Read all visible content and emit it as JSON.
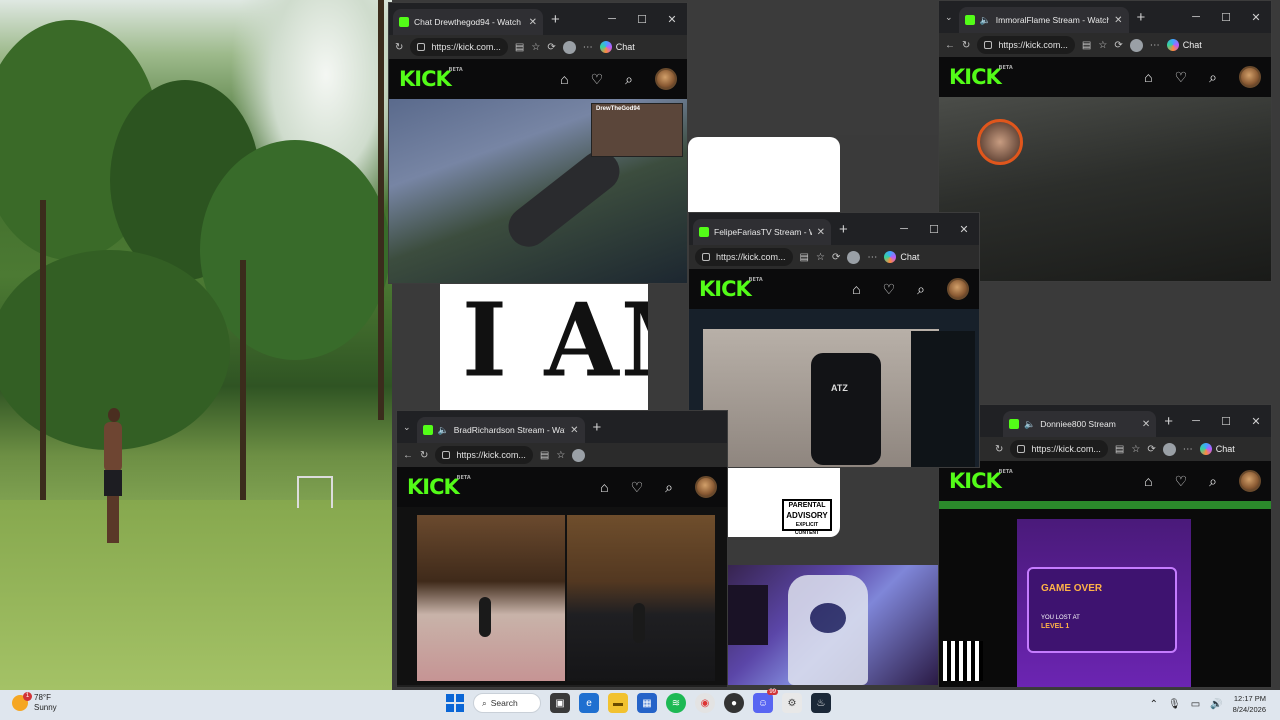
{
  "windows": {
    "drew": {
      "tab_title": "Chat Drewthegod94 - Watch",
      "url": "https://kick.com...",
      "chat_label": "Chat",
      "cam_name": "DrewTheGod94"
    },
    "immoral": {
      "tab_title": "ImmoralFlame Stream - Watch",
      "url": "https://kick.com...",
      "chat_label": "Chat"
    },
    "felipe": {
      "tab_title": "FelipeFariasTV Stream - Watc",
      "url": "https://kick.com...",
      "chat_label": "Chat",
      "chair_brand": "ATZ"
    },
    "brad": {
      "tab_title": "BradRichardson Stream - Watc",
      "url": "https://kick.com..."
    },
    "donnie": {
      "tab_title": "Donniee800 Stream",
      "url": "https://kick.com...",
      "chat_label": "Chat",
      "game_over": "GAME OVER",
      "you_lost_at": "YOU LOST AT",
      "level": "LEVEL 1"
    }
  },
  "kick": {
    "logo": "KICK",
    "beta": "BETA"
  },
  "background": {
    "poster_text": "I AM M",
    "advisory": [
      "PARENTAL",
      "ADVISORY",
      "EXPLICIT CONTENT"
    ]
  },
  "taskbar": {
    "weather_temp": "78°F",
    "weather_desc": "Sunny",
    "weather_badge": "1",
    "search_label": "Search",
    "time": "12:17 PM",
    "date": "8/24/2026",
    "discord_badge": "99"
  },
  "icons": {
    "shop": "store-icon",
    "follow": "heart-icon",
    "search": "search-icon",
    "close": "close-icon",
    "new_tab": "plus-icon"
  },
  "colors": {
    "kick_green": "#53fc18",
    "taskbar": "#dfe6ee",
    "windows_blue": "#0a66d6"
  }
}
